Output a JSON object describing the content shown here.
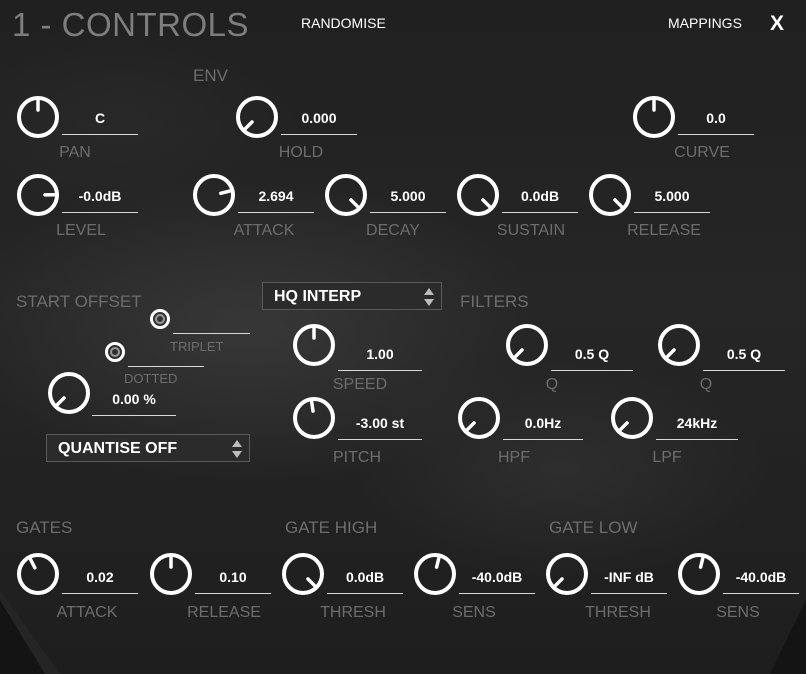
{
  "header": {
    "title": "1 - CONTROLS",
    "randomise_label": "RANDOMISE",
    "mappings_label": "MAPPINGS",
    "close_label": "X"
  },
  "sections": {
    "env": "ENV",
    "start_offset": "START OFFSET",
    "filters": "FILTERS",
    "gates": "GATES",
    "gate_high": "GATE HIGH",
    "gate_low": "GATE LOW"
  },
  "controls": {
    "pan": {
      "label": "PAN",
      "value": "C",
      "level": 0.5
    },
    "level": {
      "label": "LEVEL",
      "value": "-0.0dB",
      "level": 0.83
    },
    "hold": {
      "label": "HOLD",
      "value": "0.000",
      "level": 0.0
    },
    "curve": {
      "label": "CURVE",
      "value": "0.0",
      "level": 0.5
    },
    "attack": {
      "label": "ATTACK",
      "value": "2.694",
      "level": 0.78
    },
    "decay": {
      "label": "DECAY",
      "value": "5.000",
      "level": 1.0
    },
    "sustain": {
      "label": "SUSTAIN",
      "value": "0.0dB",
      "level": 1.0
    },
    "release": {
      "label": "RELEASE",
      "value": "5.000",
      "level": 1.0
    },
    "start_offset": {
      "value": "0.00 %",
      "level": 0.0
    },
    "speed": {
      "label": "SPEED",
      "value": "1.00",
      "level": 0.5
    },
    "pitch": {
      "label": "PITCH",
      "value": "-3.00 st",
      "level": 0.47
    },
    "filter_q1": {
      "label": "Q",
      "value": "0.5 Q",
      "level": 0.0
    },
    "filter_q2": {
      "label": "Q",
      "value": "0.5 Q",
      "level": 0.0
    },
    "hpf": {
      "label": "HPF",
      "value": "0.0Hz",
      "level": 0.0
    },
    "lpf": {
      "label": "LPF",
      "value": "24kHz",
      "level": 0.0
    },
    "gates_attack": {
      "label": "ATTACK",
      "value": "0.02",
      "level": 0.4
    },
    "gates_release": {
      "label": "RELEASE",
      "value": "0.10",
      "level": 0.5
    },
    "gate_high_thresh": {
      "label": "THRESH",
      "value": "0.0dB",
      "level": 1.0
    },
    "gate_high_sens": {
      "label": "SENS",
      "value": "-40.0dB",
      "level": 0.55
    },
    "gate_low_thresh": {
      "label": "THRESH",
      "value": "-INF dB",
      "level": 0.0
    },
    "gate_low_sens": {
      "label": "SENS",
      "value": "-40.0dB",
      "level": 0.55
    }
  },
  "start_offset_options": {
    "triplet_label": "TRIPLET",
    "dotted_label": "DOTTED",
    "quantise_value": "QUANTISE OFF"
  },
  "interp_value": "HQ INTERP",
  "colors": {
    "background": "#1c1c1c",
    "text": "#ffffff",
    "label": "#6d6d6d",
    "knob": "#ffffff",
    "underline": "#d9d9d9"
  },
  "icons": {
    "knob": "rotary-knob",
    "dropdown": "up-down-arrows-icon",
    "radio": "radio-button"
  }
}
